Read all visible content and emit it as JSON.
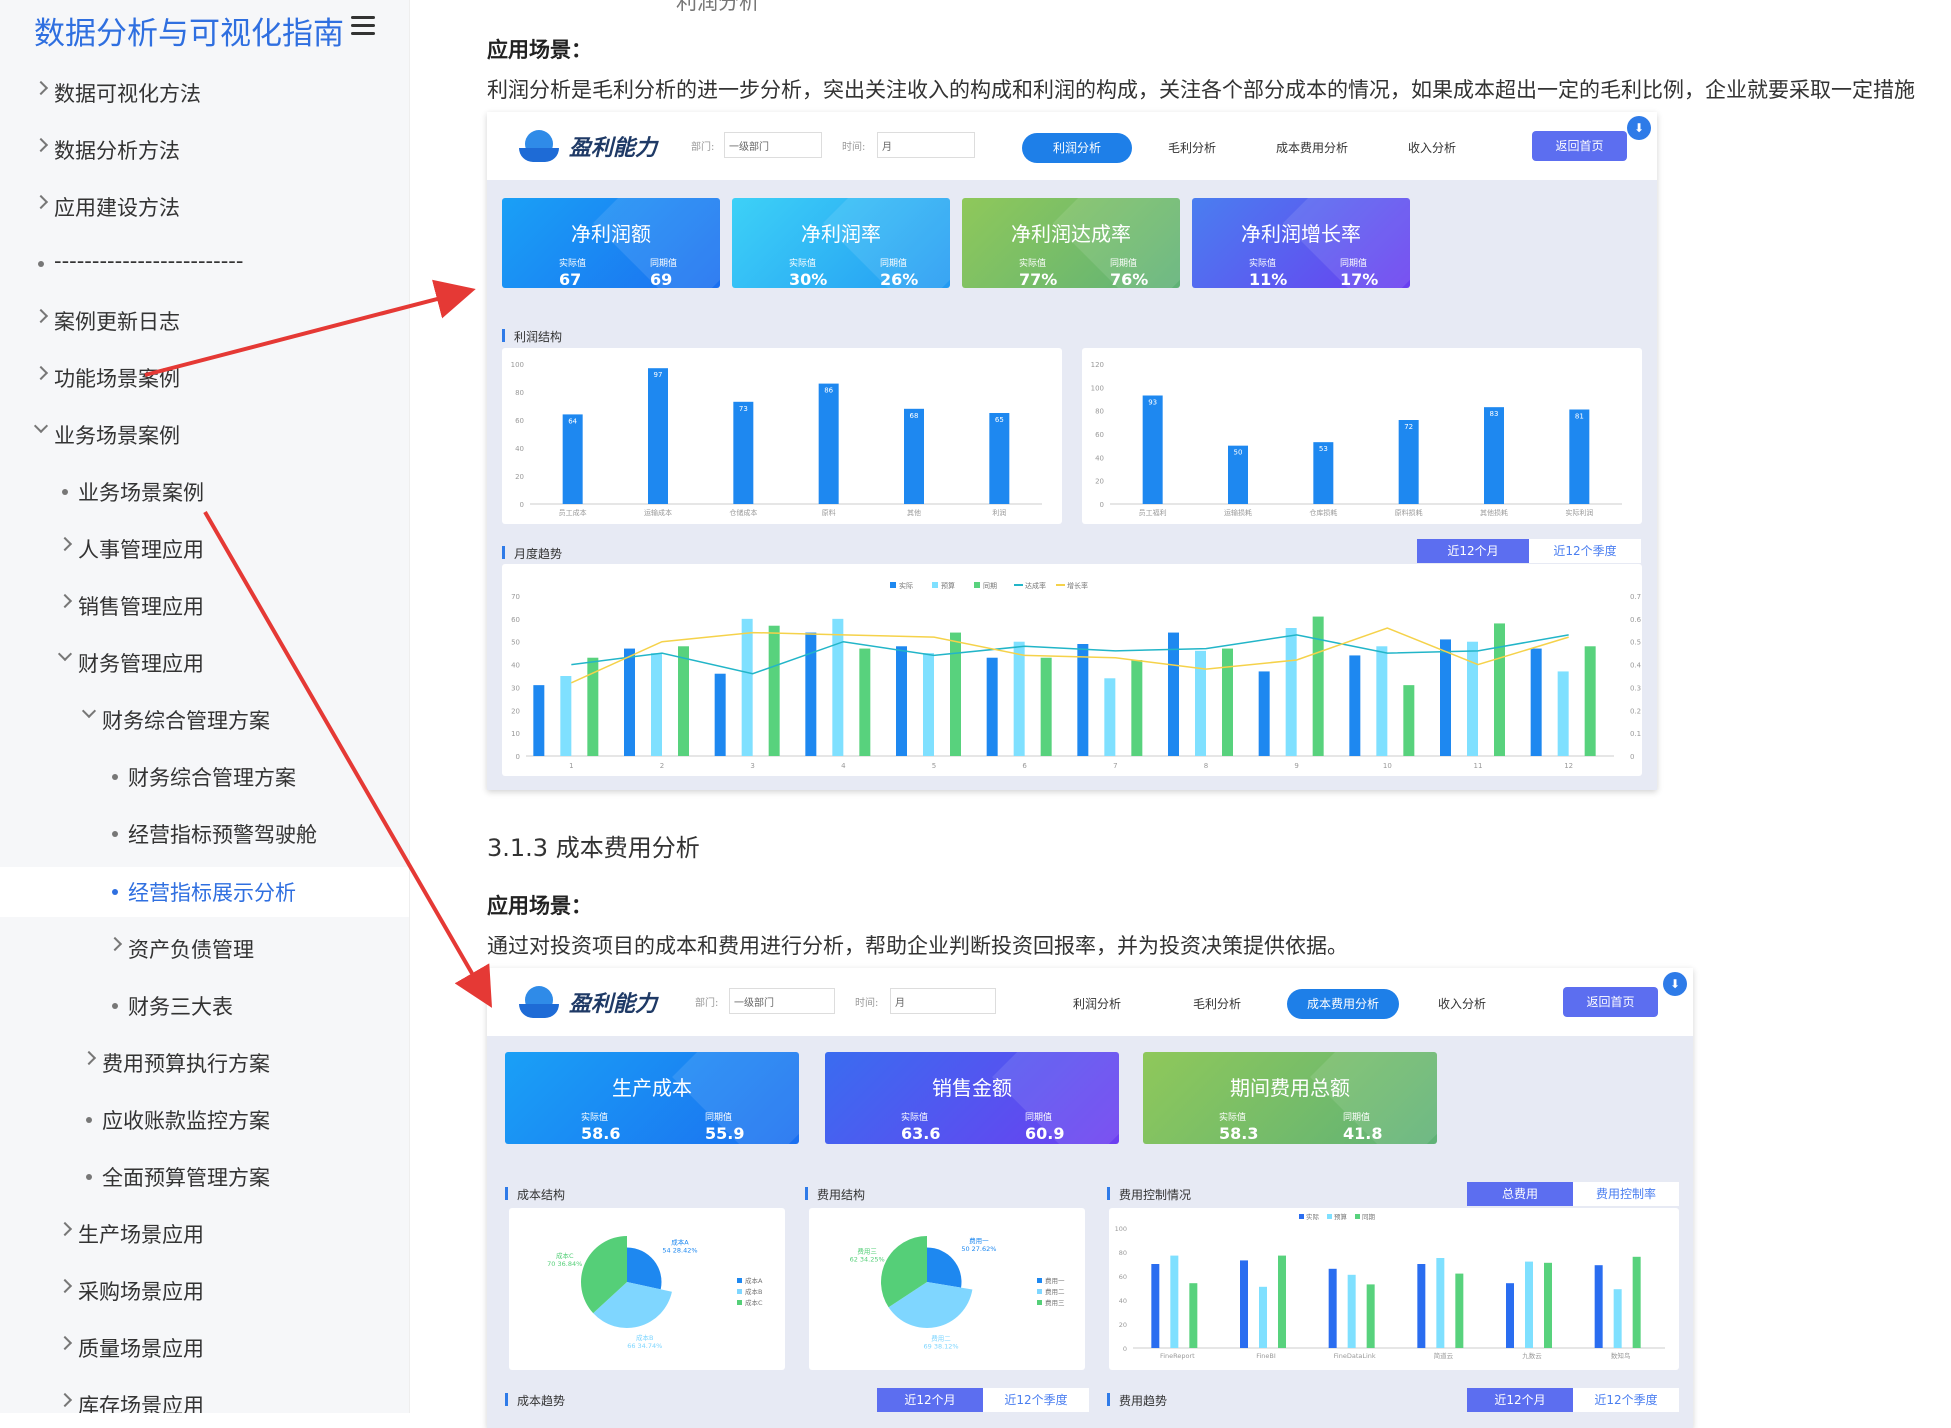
{
  "sidebar": {
    "title": "数据分析与可视化指南",
    "items": [
      {
        "label": "数据可视化方法"
      },
      {
        "label": "数据分析方法"
      },
      {
        "label": "应用建设方法"
      },
      {
        "label": "-------------------------"
      },
      {
        "label": "案例更新日志"
      },
      {
        "label": "功能场景案例"
      },
      {
        "label": "业务场景案例"
      },
      {
        "label": "业务场景案例"
      },
      {
        "label": "人事管理应用"
      },
      {
        "label": "销售管理应用"
      },
      {
        "label": "财务管理应用"
      },
      {
        "label": "财务综合管理方案"
      },
      {
        "label": "财务综合管理方案"
      },
      {
        "label": "经营指标预警驾驶舱"
      },
      {
        "label": "经营指标展示分析"
      },
      {
        "label": "资产负债管理"
      },
      {
        "label": "财务三大表"
      },
      {
        "label": "费用预算执行方案"
      },
      {
        "label": "应收账款监控方案"
      },
      {
        "label": "全面预算管理方案"
      },
      {
        "label": "生产场景应用"
      },
      {
        "label": "采购场景应用"
      },
      {
        "label": "质量场景应用"
      },
      {
        "label": "库存场景应用"
      }
    ]
  },
  "content": {
    "top_cut": "利润分析",
    "scene_label": "应用场景：",
    "profit_desc": "利润分析是毛利分析的进一步分析，突出关注收入的构成和利润的构成，关注各个部分成本的情况，如果成本超出一定的毛利比例，企业就要采取一定措施",
    "section_cost": "3.1.3 成本费用分析",
    "scene_label2": "应用场景：",
    "cost_desc": "通过对投资项目的成本和费用进行分析，帮助企业判断投资回报率，并为投资决策提供依据。"
  },
  "dash1": {
    "logo": "盈利能力",
    "dept_label": "部门:",
    "dept_value": "一级部门",
    "time_label": "时间:",
    "time_value": "月",
    "tabs": [
      "利润分析",
      "毛利分析",
      "成本费用分析",
      "收入分析"
    ],
    "home": "返回首页",
    "kpis": [
      {
        "title": "净利润额",
        "a_label": "实际值",
        "a": "67",
        "b_label": "同期值",
        "b": "69"
      },
      {
        "title": "净利润率",
        "a_label": "实际值",
        "a": "30%",
        "b_label": "同期值",
        "b": "26%"
      },
      {
        "title": "净利润达成率",
        "a_label": "实际值",
        "a": "77%",
        "b_label": "同期值",
        "b": "76%"
      },
      {
        "title": "净利润增长率",
        "a_label": "实际值",
        "a": "11%",
        "b_label": "同期值",
        "b": "17%"
      }
    ],
    "struct_label": "利润结构",
    "trend_label": "月度趋势",
    "seg_on": "近12个月",
    "seg_off": "近12个季度"
  },
  "dash2": {
    "logo": "盈利能力",
    "dept_label": "部门:",
    "dept_value": "一级部门",
    "time_label": "时间:",
    "time_value": "月",
    "tabs": [
      "利润分析",
      "毛利分析",
      "成本费用分析",
      "收入分析"
    ],
    "home": "返回首页",
    "kpis": [
      {
        "title": "生产成本",
        "a_label": "实际值",
        "a": "58.6",
        "b_label": "同期值",
        "b": "55.9"
      },
      {
        "title": "销售金额",
        "a_label": "实际值",
        "a": "63.6",
        "b_label": "同期值",
        "b": "60.9"
      },
      {
        "title": "期间费用总额",
        "a_label": "实际值",
        "a": "58.3",
        "b_label": "同期值",
        "b": "41.8"
      }
    ],
    "cost_struct": "成本结构",
    "fee_struct": "费用结构",
    "fee_ctrl": "费用控制情况",
    "seg_total": "总费用",
    "seg_rate": "费用控制率",
    "cost_trend": "成本趋势",
    "fee_trend": "费用趋势",
    "seg_on": "近12个月",
    "seg_off": "近12个季度"
  },
  "chart_data": [
    {
      "type": "bar",
      "categories": [
        "员工成本",
        "运输成本",
        "仓储成本",
        "原料",
        "其他",
        "利润"
      ],
      "values": [
        64,
        97,
        73,
        86,
        68,
        65
      ],
      "ylim": [
        0,
        100
      ],
      "ticks": [
        0,
        20,
        40,
        60,
        80,
        100
      ]
    },
    {
      "type": "bar",
      "categories": [
        "员工福利",
        "运输损耗",
        "仓库损耗",
        "原料损耗",
        "其他损耗",
        "实际利润"
      ],
      "values": [
        93,
        50,
        53,
        72,
        83,
        81
      ],
      "ylim": [
        0,
        120
      ],
      "ticks": [
        0,
        20,
        40,
        60,
        80,
        100,
        120
      ]
    },
    {
      "type": "bar",
      "categories": [
        "1",
        "2",
        "3",
        "4",
        "5",
        "6",
        "7",
        "8",
        "9",
        "10",
        "11",
        "12"
      ],
      "legend": [
        "实际",
        "预算",
        "同期",
        "达成率",
        "增长率"
      ],
      "ylim": [
        0,
        70
      ],
      "y2lim": [
        0,
        0.7
      ],
      "ticks": [
        0,
        10,
        20,
        30,
        40,
        50,
        60,
        70
      ],
      "ticks2": [
        0,
        0.1,
        0.2,
        0.3,
        0.4,
        0.5,
        0.6,
        0.7
      ],
      "series": [
        {
          "name": "实际",
          "values": [
            31,
            47,
            36,
            54,
            48,
            43,
            49,
            54,
            37,
            44,
            51,
            47
          ]
        },
        {
          "name": "预算",
          "values": [
            35,
            45,
            60,
            60,
            45,
            50,
            34,
            46,
            56,
            48,
            50,
            37
          ]
        },
        {
          "name": "同期",
          "values": [
            43,
            48,
            57,
            47,
            54,
            43,
            42,
            47,
            61,
            31,
            58,
            48
          ]
        },
        {
          "name": "达成率",
          "values": [
            0.4,
            0.45,
            0.36,
            0.5,
            0.44,
            0.48,
            0.46,
            0.47,
            0.53,
            0.45,
            0.46,
            0.53
          ]
        },
        {
          "name": "增长率",
          "values": [
            0.32,
            0.5,
            0.54,
            0.53,
            0.52,
            0.44,
            0.43,
            0.38,
            0.42,
            0.56,
            0.4,
            0.52
          ]
        }
      ]
    },
    {
      "type": "pie",
      "slices": [
        {
          "name": "成本A",
          "value": 54,
          "pct": "28.42%"
        },
        {
          "name": "成本B",
          "value": 66,
          "pct": "34.74%"
        },
        {
          "name": "成本C",
          "value": 70,
          "pct": "36.84%"
        }
      ]
    },
    {
      "type": "pie",
      "slices": [
        {
          "name": "费用一",
          "value": 50,
          "pct": "27.62%"
        },
        {
          "name": "费用二",
          "value": 69,
          "pct": "38.12%"
        },
        {
          "name": "费用三",
          "value": 62,
          "pct": "34.25%"
        }
      ]
    },
    {
      "type": "bar",
      "categories": [
        "FineReport",
        "FineBI",
        "FineDataLink",
        "简道云",
        "九数云",
        "数知鸟"
      ],
      "legend": [
        "实际",
        "预算",
        "同期"
      ],
      "ylim": [
        0,
        100
      ],
      "ticks": [
        0,
        20,
        40,
        60,
        80,
        100
      ],
      "series": [
        {
          "name": "实际",
          "values": [
            70,
            73,
            66,
            70,
            54,
            69
          ]
        },
        {
          "name": "预算",
          "values": [
            77,
            51,
            61,
            75,
            72,
            49
          ]
        },
        {
          "name": "同期",
          "values": [
            54,
            77,
            53,
            62,
            71,
            76
          ]
        }
      ]
    }
  ],
  "colors": {
    "accent": "#2f6fe0",
    "arrow": "#e53935",
    "bar_blue": "#1e88f0",
    "bar_cyan": "#7fe0ff",
    "bar_green": "#58d27d"
  }
}
